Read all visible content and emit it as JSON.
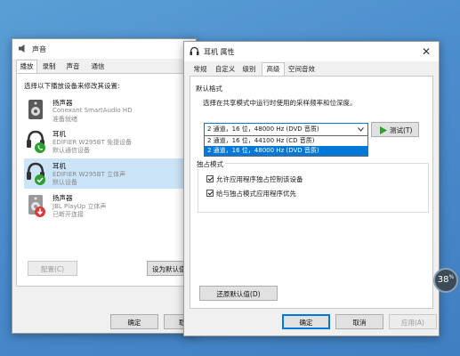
{
  "sound_window": {
    "title": "声音",
    "tabs": [
      "播放",
      "录制",
      "声音",
      "通信"
    ],
    "instruction": "选择以下播放设备来修改其设置:",
    "devices": [
      {
        "name": "扬声器",
        "line1": "Conexant SmartAudio HD",
        "line2": "准备就绪",
        "icon": "speaker-icon",
        "badge": ""
      },
      {
        "name": "耳机",
        "line1": "EDIFIER W295BT 免提设备",
        "line2": "默认通信设备",
        "icon": "headphones-icon",
        "badge": "phone-badge-icon"
      },
      {
        "name": "耳机",
        "line1": "EDIFIER W295BT 立体声",
        "line2": "默认设备",
        "icon": "headphones-icon",
        "badge": "check-badge-icon"
      },
      {
        "name": "扬声器",
        "line1": "JBL PlayUp 立体声",
        "line2": "已断开连接",
        "icon": "speaker-icon",
        "badge": "down-arrow-badge-icon"
      }
    ],
    "configure_label": "配置(C)",
    "set_default_label": "设为默认值(",
    "ok_label": "确定",
    "cancel_partial": "取"
  },
  "props_window": {
    "title": "耳机 属性",
    "close_glyph": "✕",
    "tabs": [
      "常规",
      "自定义",
      "级别",
      "高级",
      "空间音效"
    ],
    "default_format_label": "默认格式",
    "default_format_desc": "选择在共享模式中运行时使用的采样频率和位深度。",
    "selected_format": "2 通道，16 位，48000 Hz (DVD 音质)",
    "dropdown_options": [
      "2 通道，16 位，44100 Hz (CD 音质)",
      "2 通道，16 位，48000 Hz (DVD 音质)"
    ],
    "test_label": "测试(T)",
    "exclusive_label": "独占模式",
    "exclusive_opt1": "允许应用程序独占控制该设备",
    "exclusive_opt2": "给与独占模式应用程序优先",
    "restore_label": "还原默认值(D)",
    "ok_label": "确定",
    "cancel_label": "取消",
    "apply_label": "应用(A)"
  },
  "badge": {
    "text": "38",
    "sup": "%"
  },
  "colors": {
    "selection": "#0078d7",
    "selected_row": "#cce4f7",
    "play_green": "#2e9e2e"
  }
}
